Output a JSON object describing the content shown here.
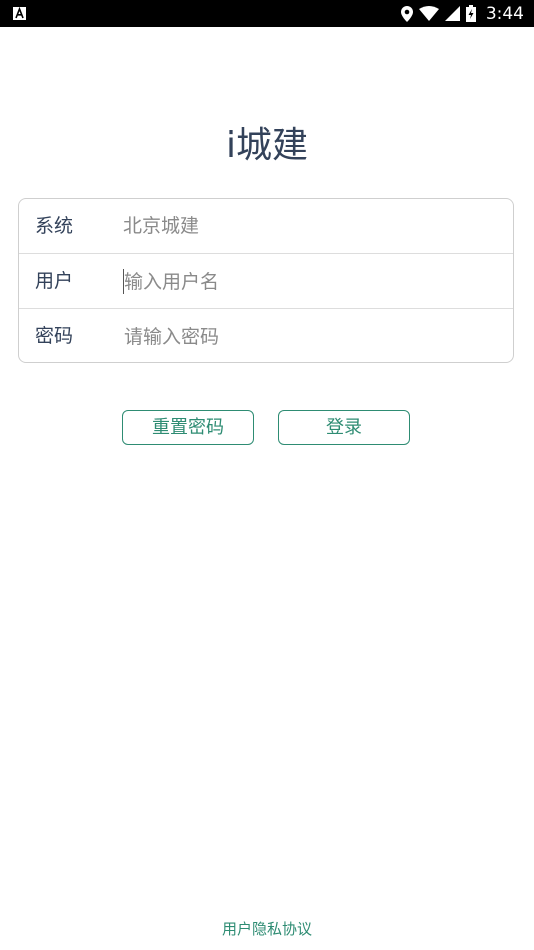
{
  "status_bar": {
    "time": "3:44",
    "left_icon": "a-badge-icon",
    "right_icons": [
      "location-icon",
      "wifi-icon",
      "cell-signal-icon",
      "battery-charging-icon"
    ]
  },
  "app": {
    "title": "i城建"
  },
  "form": {
    "system": {
      "label": "系统",
      "value": "北京城建"
    },
    "user": {
      "label": "用户",
      "placeholder": "输入用户名"
    },
    "password": {
      "label": "密码",
      "placeholder": "请输入密码"
    }
  },
  "buttons": {
    "reset_label": "重置密码",
    "login_label": "登录"
  },
  "footer": {
    "privacy_label": "用户隐私协议"
  },
  "colors": {
    "accent": "#2e8c73",
    "title": "#33425a",
    "status_bar": "#000000"
  }
}
